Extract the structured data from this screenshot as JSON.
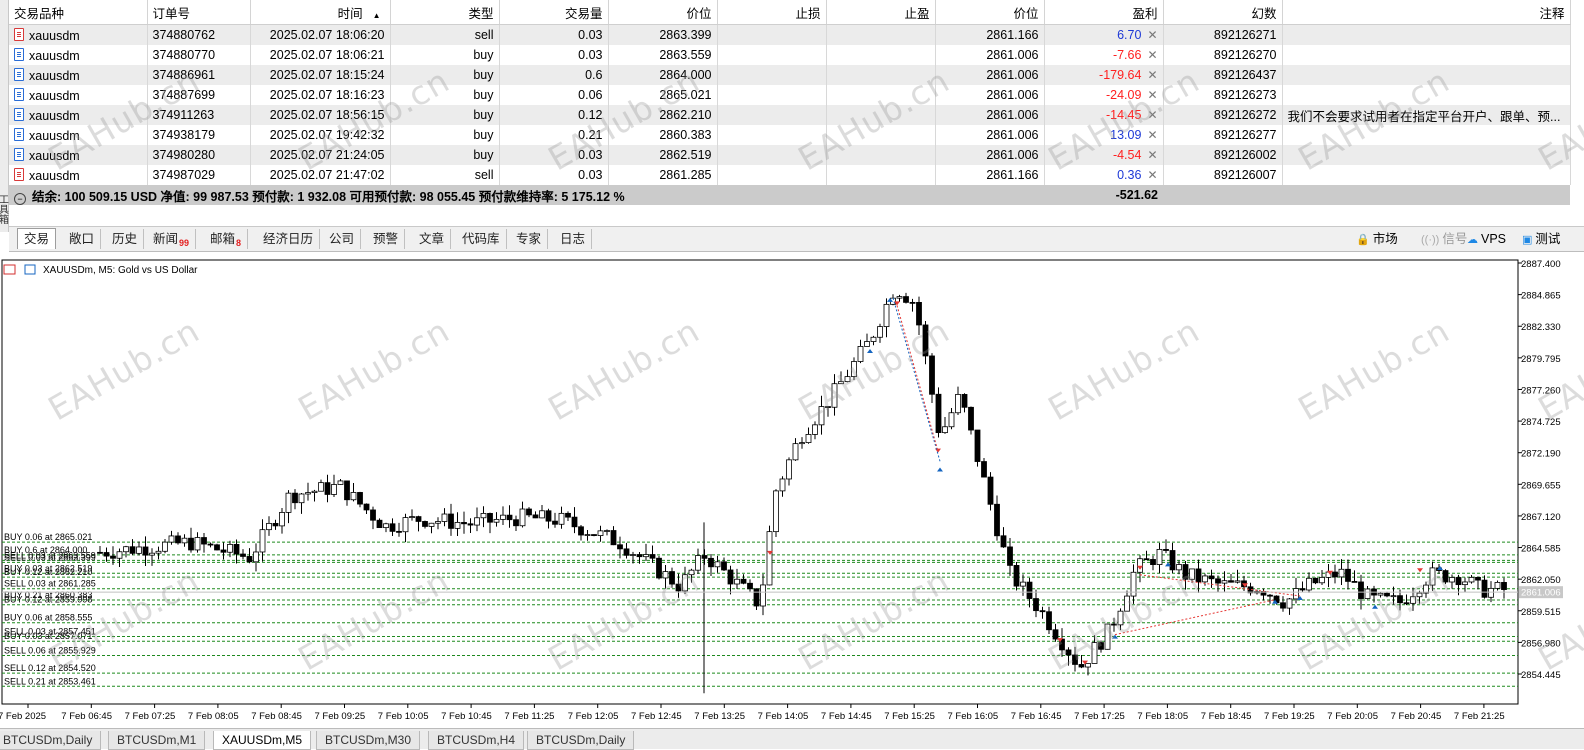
{
  "terminal": {
    "side_label": "工具箱",
    "columns": {
      "symbol": "交易品种",
      "order": "订单号",
      "time": "时间",
      "sort_indicator": "▲",
      "type": "类型",
      "volume": "交易量",
      "price": "价位",
      "sl": "止损",
      "tp": "止盈",
      "cur_price": "价位",
      "profit": "盈利",
      "magic": "幻数",
      "comment": "注释"
    },
    "rows": [
      {
        "symbol": "xauusdm",
        "order": "374880762",
        "time": "2025.02.07 18:06:20",
        "type": "sell",
        "volume": "0.03",
        "price": "2863.399",
        "sl": "",
        "tp": "",
        "cur_price": "2861.166",
        "profit": "6.70",
        "profit_sign": "pos",
        "magic": "892126271",
        "comment": ""
      },
      {
        "symbol": "xauusdm",
        "order": "374880770",
        "time": "2025.02.07 18:06:21",
        "type": "buy",
        "volume": "0.03",
        "price": "2863.559",
        "sl": "",
        "tp": "",
        "cur_price": "2861.006",
        "profit": "-7.66",
        "profit_sign": "neg",
        "magic": "892126270",
        "comment": ""
      },
      {
        "symbol": "xauusdm",
        "order": "374886961",
        "time": "2025.02.07 18:15:24",
        "type": "buy",
        "volume": "0.6",
        "price": "2864.000",
        "sl": "",
        "tp": "",
        "cur_price": "2861.006",
        "profit": "-179.64",
        "profit_sign": "neg",
        "magic": "892126437",
        "comment": ""
      },
      {
        "symbol": "xauusdm",
        "order": "374887699",
        "time": "2025.02.07 18:16:23",
        "type": "buy",
        "volume": "0.06",
        "price": "2865.021",
        "sl": "",
        "tp": "",
        "cur_price": "2861.006",
        "profit": "-24.09",
        "profit_sign": "neg",
        "magic": "892126273",
        "comment": ""
      },
      {
        "symbol": "xauusdm",
        "order": "374911263",
        "time": "2025.02.07 18:56:15",
        "type": "buy",
        "volume": "0.12",
        "price": "2862.210",
        "sl": "",
        "tp": "",
        "cur_price": "2861.006",
        "profit": "-14.45",
        "profit_sign": "neg",
        "magic": "892126272",
        "comment": "我们不会要求试用者在指定平台开户、跟单、预..."
      },
      {
        "symbol": "xauusdm",
        "order": "374938179",
        "time": "2025.02.07 19:42:32",
        "type": "buy",
        "volume": "0.21",
        "price": "2860.383",
        "sl": "",
        "tp": "",
        "cur_price": "2861.006",
        "profit": "13.09",
        "profit_sign": "pos",
        "magic": "892126277",
        "comment": ""
      },
      {
        "symbol": "xauusdm",
        "order": "374980280",
        "time": "2025.02.07 21:24:05",
        "type": "buy",
        "volume": "0.03",
        "price": "2862.519",
        "sl": "",
        "tp": "",
        "cur_price": "2861.006",
        "profit": "-4.54",
        "profit_sign": "neg",
        "magic": "892126002",
        "comment": ""
      },
      {
        "symbol": "xauusdm",
        "order": "374987029",
        "time": "2025.02.07 21:47:02",
        "type": "sell",
        "volume": "0.03",
        "price": "2861.285",
        "sl": "",
        "tp": "",
        "cur_price": "2861.166",
        "profit": "0.36",
        "profit_sign": "pos",
        "magic": "892126007",
        "comment": ""
      }
    ],
    "summary": {
      "text": "结余: 100 509.15 USD  净值: 99 987.53  预付款: 1 932.08  可用预付款: 98 055.45  预付款维持率: 5 175.12 %",
      "total_profit": "-521.62"
    },
    "tabs": [
      {
        "label": "交易",
        "badge": ""
      },
      {
        "label": "敞口",
        "badge": ""
      },
      {
        "label": "历史",
        "badge": ""
      },
      {
        "label": "新闻",
        "badge": "99"
      },
      {
        "label": "邮箱",
        "badge": "8"
      },
      {
        "label": "经济日历",
        "badge": ""
      },
      {
        "label": "公司",
        "badge": ""
      },
      {
        "label": "预警",
        "badge": ""
      },
      {
        "label": "文章",
        "badge": ""
      },
      {
        "label": "代码库",
        "badge": ""
      },
      {
        "label": "专家",
        "badge": ""
      },
      {
        "label": "日志",
        "badge": ""
      }
    ],
    "right_tabs": {
      "market": "市场",
      "signals": "信号",
      "vps": "VPS",
      "tester": "测试"
    }
  },
  "watermark": "EAHub.cn",
  "chart": {
    "header": "XAUUSDm, M5:  Gold vs US Dollar",
    "current_price_label": "2861.006",
    "price_axis": [
      "2887.400",
      "2884.865",
      "2882.330",
      "2879.795",
      "2877.260",
      "2874.725",
      "2872.190",
      "2869.655",
      "2867.120",
      "2864.585",
      "2862.050",
      "2859.515",
      "2856.980",
      "2854.445"
    ],
    "time_axis": [
      "7 Feb 2025",
      "7 Feb 06:45",
      "7 Feb 07:25",
      "7 Feb 08:05",
      "7 Feb 08:45",
      "7 Feb 09:25",
      "7 Feb 10:05",
      "7 Feb 10:45",
      "7 Feb 11:25",
      "7 Feb 12:05",
      "7 Feb 12:45",
      "7 Feb 13:25",
      "7 Feb 14:05",
      "7 Feb 14:45",
      "7 Feb 15:25",
      "7 Feb 16:05",
      "7 Feb 16:45",
      "7 Feb 17:25",
      "7 Feb 18:05",
      "7 Feb 18:45",
      "7 Feb 19:25",
      "7 Feb 20:05",
      "7 Feb 20:45",
      "7 Feb 21:25"
    ],
    "order_lines": [
      {
        "label": "BUY 0.06 at 2865.021",
        "price": 2865.021
      },
      {
        "label": "BUY 0.6 at 2864.000",
        "price": 2864.0
      },
      {
        "label": "SELL 0.03 at 2863.559",
        "price": 2863.559
      },
      {
        "label": "SELL 0.03 at 2863.399",
        "price": 2863.399
      },
      {
        "label": "BUY 0.03 at 2862.519",
        "price": 2862.519
      },
      {
        "label": "BUY 0.12 at 2862.210",
        "price": 2862.21
      },
      {
        "label": "SELL 0.03 at 2861.285",
        "price": 2861.285
      },
      {
        "label": "BUY 0.21 at 2860.383",
        "price": 2860.383
      },
      {
        "label": "BUY 0.12 at 2859.998",
        "price": 2859.998
      },
      {
        "label": "BUY 0.06 at 2858.555",
        "price": 2858.555
      },
      {
        "label": "SELL 0.03 at 2857.451",
        "price": 2857.451
      },
      {
        "label": "BUY 0.03 at 2857.071",
        "price": 2857.071
      },
      {
        "label": "SELL 0.06 at 2855.929",
        "price": 2855.929
      },
      {
        "label": "SELL 0.12 at 2854.520",
        "price": 2854.52
      },
      {
        "label": "SELL 0.21 at 2853.461",
        "price": 2853.461
      }
    ],
    "colors": {
      "up": "#ffffff",
      "down": "#000000",
      "grid_line": "#1f8a1f",
      "buy_arrow": "#1565c0",
      "sell_arrow": "#e53935"
    }
  },
  "bottom_tabs": [
    {
      "label": "BTCUSDm,Daily"
    },
    {
      "label": "BTCUSDm,M1"
    },
    {
      "label": "XAUUSDm,M5",
      "active": true
    },
    {
      "label": "BTCUSDm,M30"
    },
    {
      "label": "BTCUSDm,H4"
    },
    {
      "label": "BTCUSDm,Daily"
    }
  ]
}
